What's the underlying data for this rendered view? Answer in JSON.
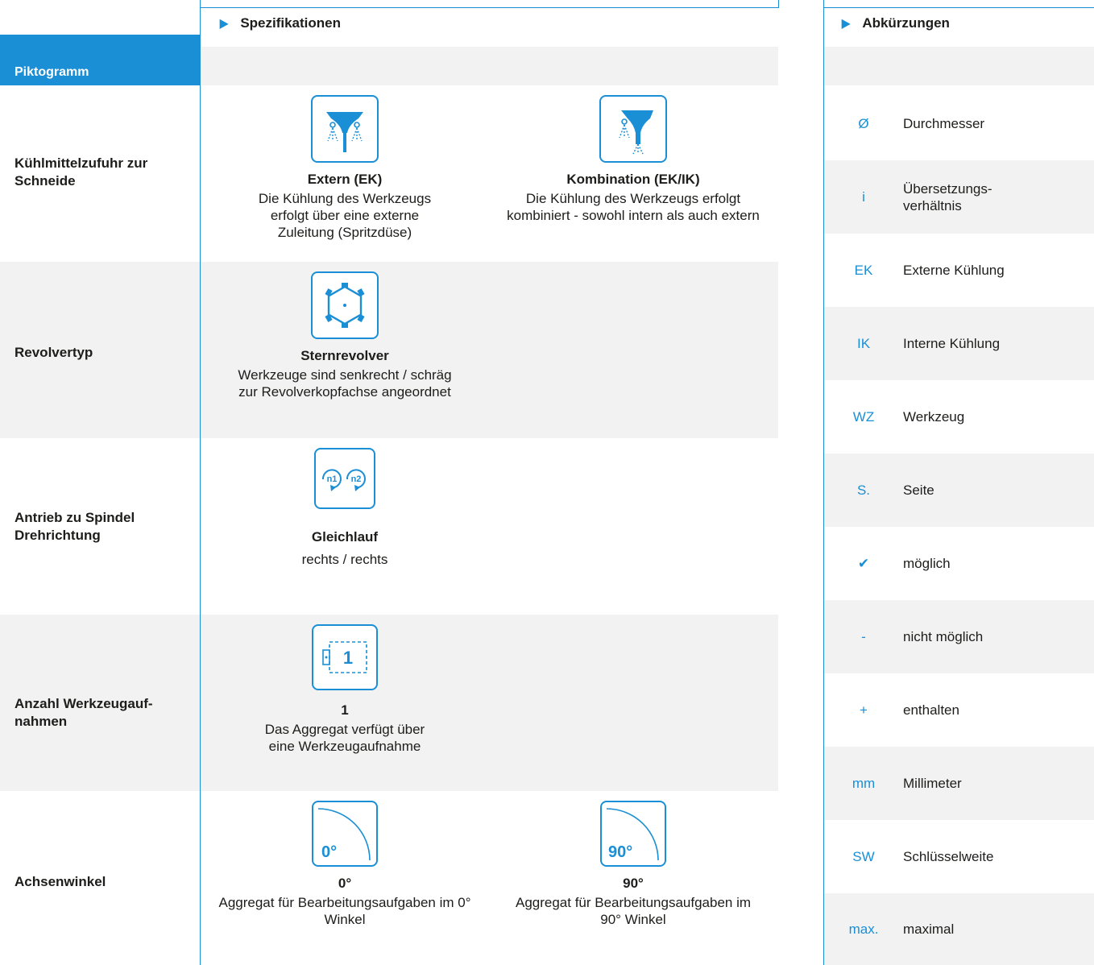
{
  "spec": {
    "header": "Spezifikationen",
    "pikto_label": "Piktogramm",
    "rows": [
      {
        "label": "Kühlmittelzufuhr zur Schneide",
        "cells": [
          {
            "icon": "external-coolant-icon",
            "title": "Extern (EK)",
            "desc": "Die Kühlung des Werkzeugs erfolgt über eine externe Zuleitung (Spritzdüse)"
          },
          {
            "icon": "combined-coolant-icon",
            "title": "Kombination (EK/IK)",
            "desc": "Die Kühlung des Werkzeugs erfolgt kombiniert - sowohl intern als auch extern"
          }
        ]
      },
      {
        "label": "Revolvertyp",
        "cells": [
          {
            "icon": "star-turret-icon",
            "title": "Sternrevolver",
            "desc": "Werkzeuge sind senkrecht / schräg zur Revolverkopfachse angeordnet"
          }
        ]
      },
      {
        "label": "Antrieb zu Spindel Drehrichtung",
        "cells": [
          {
            "icon": "rotation-direction-icon",
            "icon_text_1": "n1",
            "icon_text_2": "n2",
            "title": "Gleichlauf",
            "desc": "rechts / rechts"
          }
        ]
      },
      {
        "label": "Anzahl Werkzeugauf-nahmen",
        "cells": [
          {
            "icon": "tool-holder-count-icon",
            "icon_text": "1",
            "title": "1",
            "desc": "Das Aggregat verfügt über eine Werkzeugaufnahme"
          }
        ]
      },
      {
        "label": "Achsenwinkel",
        "cells": [
          {
            "icon": "angle-0-icon",
            "icon_text": "0°",
            "title": "0°",
            "desc": "Aggregat für Bearbeitungsaufgaben im 0° Winkel"
          },
          {
            "icon": "angle-90-icon",
            "icon_text": "90°",
            "title": "90°",
            "desc": "Aggregat für Bearbeitungsaufgaben im 90° Winkel"
          }
        ]
      }
    ]
  },
  "abbreviations": {
    "header": "Abkürzungen",
    "items": [
      {
        "symbol": "Ø",
        "text": "Durchmesser"
      },
      {
        "symbol": "i",
        "text": "Übersetzungs-verhältnis"
      },
      {
        "symbol": "EK",
        "text": "Externe Kühlung"
      },
      {
        "symbol": "IK",
        "text": "Interne Kühlung"
      },
      {
        "symbol": "WZ",
        "text": "Werkzeug"
      },
      {
        "symbol": "S.",
        "text": "Seite"
      },
      {
        "symbol": "✔",
        "text": "möglich"
      },
      {
        "symbol": "-",
        "text": "nicht möglich"
      },
      {
        "symbol": "+",
        "text": "enthalten"
      },
      {
        "symbol": "mm",
        "text": "Millimeter"
      },
      {
        "symbol": "SW",
        "text": "Schlüsselweite"
      },
      {
        "symbol": "max.",
        "text": "maximal"
      }
    ]
  },
  "colors": {
    "accent": "#1a8fd6",
    "band": "#f2f2f2",
    "text": "#1d1d1b"
  }
}
